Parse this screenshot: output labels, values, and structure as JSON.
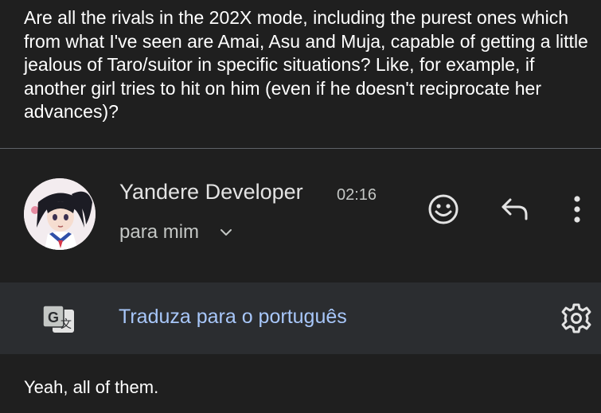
{
  "quoted_question": "Are all the rivals in the 202X mode, including the purest ones which from what I've seen are Amai, Asu and Muja, capable of getting a little jealous of Taro/suitor in specific situations? Like, for example, if another girl tries to hit on him (even if he doesn't reciprocate her advances)?",
  "message": {
    "sender_name": "Yandere Developer",
    "time": "02:16",
    "recipient_label": "para mim",
    "actions": {
      "emoji_icon": "emoji-reaction-icon",
      "reply_icon": "reply-icon",
      "more_icon": "more-vert-icon"
    }
  },
  "translate": {
    "icon": "translate-icon",
    "link_label": "Traduza para o português",
    "settings_icon": "gear-icon"
  },
  "body_text": "Yeah, all of them.",
  "colors": {
    "background": "#1f1f1f",
    "translate_bar": "#2b2d30",
    "link": "#a8c7fa",
    "text": "#e3e3e3",
    "secondary_text": "#c4c7c5"
  }
}
